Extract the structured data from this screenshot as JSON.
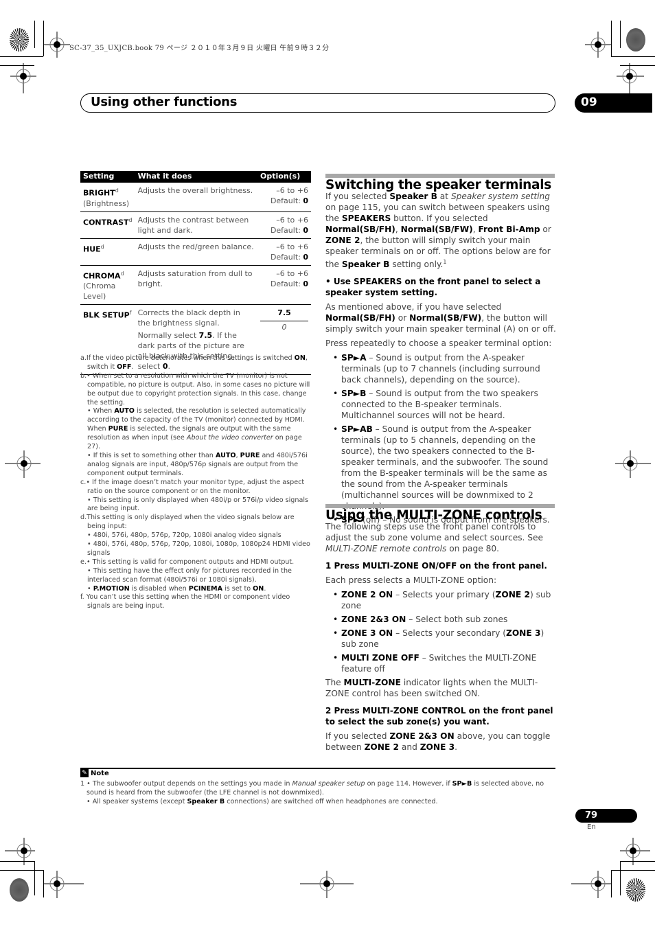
{
  "print_header": "SC-37_35_UXJCB.book  79 ページ  ２０１０年３月９日  火曜日  午前９時３２分",
  "chapter": {
    "title": "Using other functions",
    "number": "09"
  },
  "table": {
    "headers": [
      "Setting",
      "What it does",
      "Option(s)"
    ],
    "rows": [
      {
        "name": "BRIGHT",
        "sup": "d",
        "sub": "(Brightness)",
        "desc": "Adjusts the overall brightness.",
        "range": "–6 to +6",
        "default_label": "Default:",
        "default_value": "0"
      },
      {
        "name": "CONTRAST",
        "sup": "d",
        "sub": "",
        "desc": "Adjusts the contrast between light and dark.",
        "range": "–6 to +6",
        "default_label": "Default:",
        "default_value": "0"
      },
      {
        "name": "HUE",
        "sup": "d",
        "sub": "",
        "desc": "Adjusts the red/green balance.",
        "range": "–6 to +6",
        "default_label": "Default:",
        "default_value": "0"
      },
      {
        "name": "CHROMA",
        "sup": "d",
        "sub": "(Chroma Level)",
        "desc": "Adjusts saturation from dull to bright.",
        "range": "–6 to +6",
        "default_label": "Default:",
        "default_value": "0"
      }
    ],
    "blk_setup": {
      "name": "BLK SETUP",
      "sup": "f",
      "desc1": "Corrects the black depth in the brightness signal.",
      "desc2_pre": "Normally select ",
      "desc2_b1": "7.5",
      "desc2_mid": ". If the dark parts of the picture are all black with this setting, select ",
      "desc2_b2": "0",
      "desc2_end": ".",
      "option1": "7.5",
      "option2": "0"
    }
  },
  "footnotes": {
    "a": {
      "pre": "a.If the video picture deteriorates when this settings is switched ",
      "b1": "ON",
      "mid": ", switch it ",
      "b2": "OFF",
      "end": "."
    },
    "b1": "b.• When set to a resolution with which the TV (monitor) is not compatible, no picture is output. Also, in some cases no picture will be output due to copyright protection signals. In this case, change the setting.",
    "b2": {
      "pre": "• When ",
      "b1": "AUTO",
      "mid1": " is selected, the resolution is selected automatically according to the capacity of the TV (monitor) connected by HDMI. When ",
      "b2": "PURE",
      "mid2": " is selected, the signals are output with the same resolution as when input (see ",
      "i": "About the video converter",
      "end": " on page 27)."
    },
    "b3": {
      "pre": "• If this is set to something other than ",
      "b1": "AUTO",
      "mid": ", ",
      "b2": "PURE",
      "end": " and 480i/576i analog signals are input, 480p/576p signals are output from the component output terminals."
    },
    "c1": "c.• If the image doesn’t match your monitor type, adjust the aspect ratio on the source component or on the monitor.",
    "c2": "• This setting is only displayed when 480i/p or 576i/p video signals are being input.",
    "d1": "d.This setting is only displayed when the video signals below are being input:",
    "d2": "• 480i, 576i, 480p, 576p, 720p, 1080i analog video signals",
    "d3": "• 480i, 576i, 480p, 576p, 720p, 1080i, 1080p, 1080p24 HDMI video signals",
    "e1": "e.• This setting is valid for component outputs and HDMI output.",
    "e2": "• This setting have the effect only for pictures recorded in the interlaced scan format (480i/576i or 1080i signals).",
    "e3": {
      "pre": "• ",
      "b1": "P.MOTION",
      "mid1": " is disabled when ",
      "b2": "PCINEMA",
      "mid2": " is set to ",
      "b3": "ON",
      "end": "."
    },
    "f": "f. You can’t use this setting when the HDMI or component video signals are  being input."
  },
  "speaker_section": {
    "title": "Switching the speaker terminals",
    "intro": {
      "t1": "If you selected ",
      "b1": "Speaker B",
      "t2": " at ",
      "i1": "Speaker system setting",
      "t3": " on page 115, you can switch between speakers using the ",
      "b2": "SPEAKERS",
      "t4": " button. If you selected ",
      "b3": "Normal(SB/FH)",
      "t5": ", ",
      "b4": "Normal(SB/FW)",
      "t6": ", ",
      "b5": "Front Bi-Amp",
      "t7": " or ",
      "b6": "ZONE 2",
      "t8": ", the button will simply switch your main speaker terminals on or off. The options below are for the ",
      "b7": "Speaker B",
      "t9": " setting only.",
      "sup": "1"
    },
    "step": "•    Use SPEAKERS on the front panel to select a speaker system setting.",
    "step_body": {
      "t1": "As mentioned above, if you have selected ",
      "b1": "Normal(SB/FH)",
      "t2": " or ",
      "b2": "Normal(SB/FW)",
      "t3": ", the button will simply switch your main speaker terminal (A) on or off."
    },
    "press": "Press repeatedly to choose a speaker terminal option:",
    "options": [
      {
        "label": "SP►A",
        "text": " – Sound is output from the A-speaker terminals (up to 7 channels (including surround back channels), depending on the source)."
      },
      {
        "label": "SP►B",
        "text": " – Sound is output from the two speakers connected to the B-speaker terminals. Multichannel sources will not be heard."
      },
      {
        "label": "SP►AB",
        "text": " – Sound is output from the A-speaker terminals (up to 5 channels, depending on the source), the two speakers connected to the B-speaker terminals, and the subwoofer. The sound from the B-speaker terminals will be the same as the sound from the A-speaker terminals (multichannel sources will be downmixed to 2 channels)."
      },
      {
        "label": "SP►",
        "text": " (off) – No sound is output from the speakers."
      }
    ]
  },
  "multizone_section": {
    "title": "Using the MULTI-ZONE controls",
    "intro": {
      "t1": "The following steps use the front panel controls to adjust the sub zone volume and select sources. See ",
      "i1": "MULTI-ZONE remote controls",
      "t2": " on page 80."
    },
    "step1": "1    Press MULTI-ZONE ON/OFF on the front panel.",
    "step1_body": "Each press selects a MULTI-ZONE option:",
    "options": [
      {
        "label": "ZONE 2 ON",
        "t1": " – Selects your primary (",
        "b": "ZONE 2",
        "t2": ") sub zone"
      },
      {
        "label": "ZONE 2&3 ON",
        "t1": " – Select both sub zones",
        "b": "",
        "t2": ""
      },
      {
        "label": "ZONE 3 ON",
        "t1": " – Selects your secondary (",
        "b": "ZONE 3",
        "t2": ") sub zone"
      },
      {
        "label": "MULTI ZONE OFF",
        "t1": " – Switches the MULTI-ZONE feature off",
        "b": "",
        "t2": ""
      }
    ],
    "indicator": {
      "t1": "The ",
      "b1": "MULTI-ZONE",
      "t2": " indicator lights when the MULTI-ZONE control has been switched ON."
    },
    "step2": "2    Press MULTI-ZONE CONTROL on the front panel to select the sub zone(s) you want.",
    "step2_body": {
      "t1": "If you selected ",
      "b1": "ZONE 2&3 ON",
      "t2": " above, you can toggle between ",
      "b2": "ZONE 2",
      "t3": " and ",
      "b3": "ZONE 3",
      "t4": "."
    }
  },
  "note": {
    "heading": "Note",
    "n1": {
      "t1": "1 • The subwoofer output depends on the settings you made in ",
      "i1": "Manual speaker setup",
      "t2": " on page 114. However, if ",
      "b1": "SP►B",
      "t3": " is selected above, no sound is heard from the subwoofer (the LFE channel is not downmixed)."
    },
    "n2": {
      "t1": "• All speaker systems (except ",
      "b1": "Speaker B",
      "t2": " connections) are switched off when headphones are connected."
    }
  },
  "page": {
    "number": "79",
    "lang": "En"
  }
}
